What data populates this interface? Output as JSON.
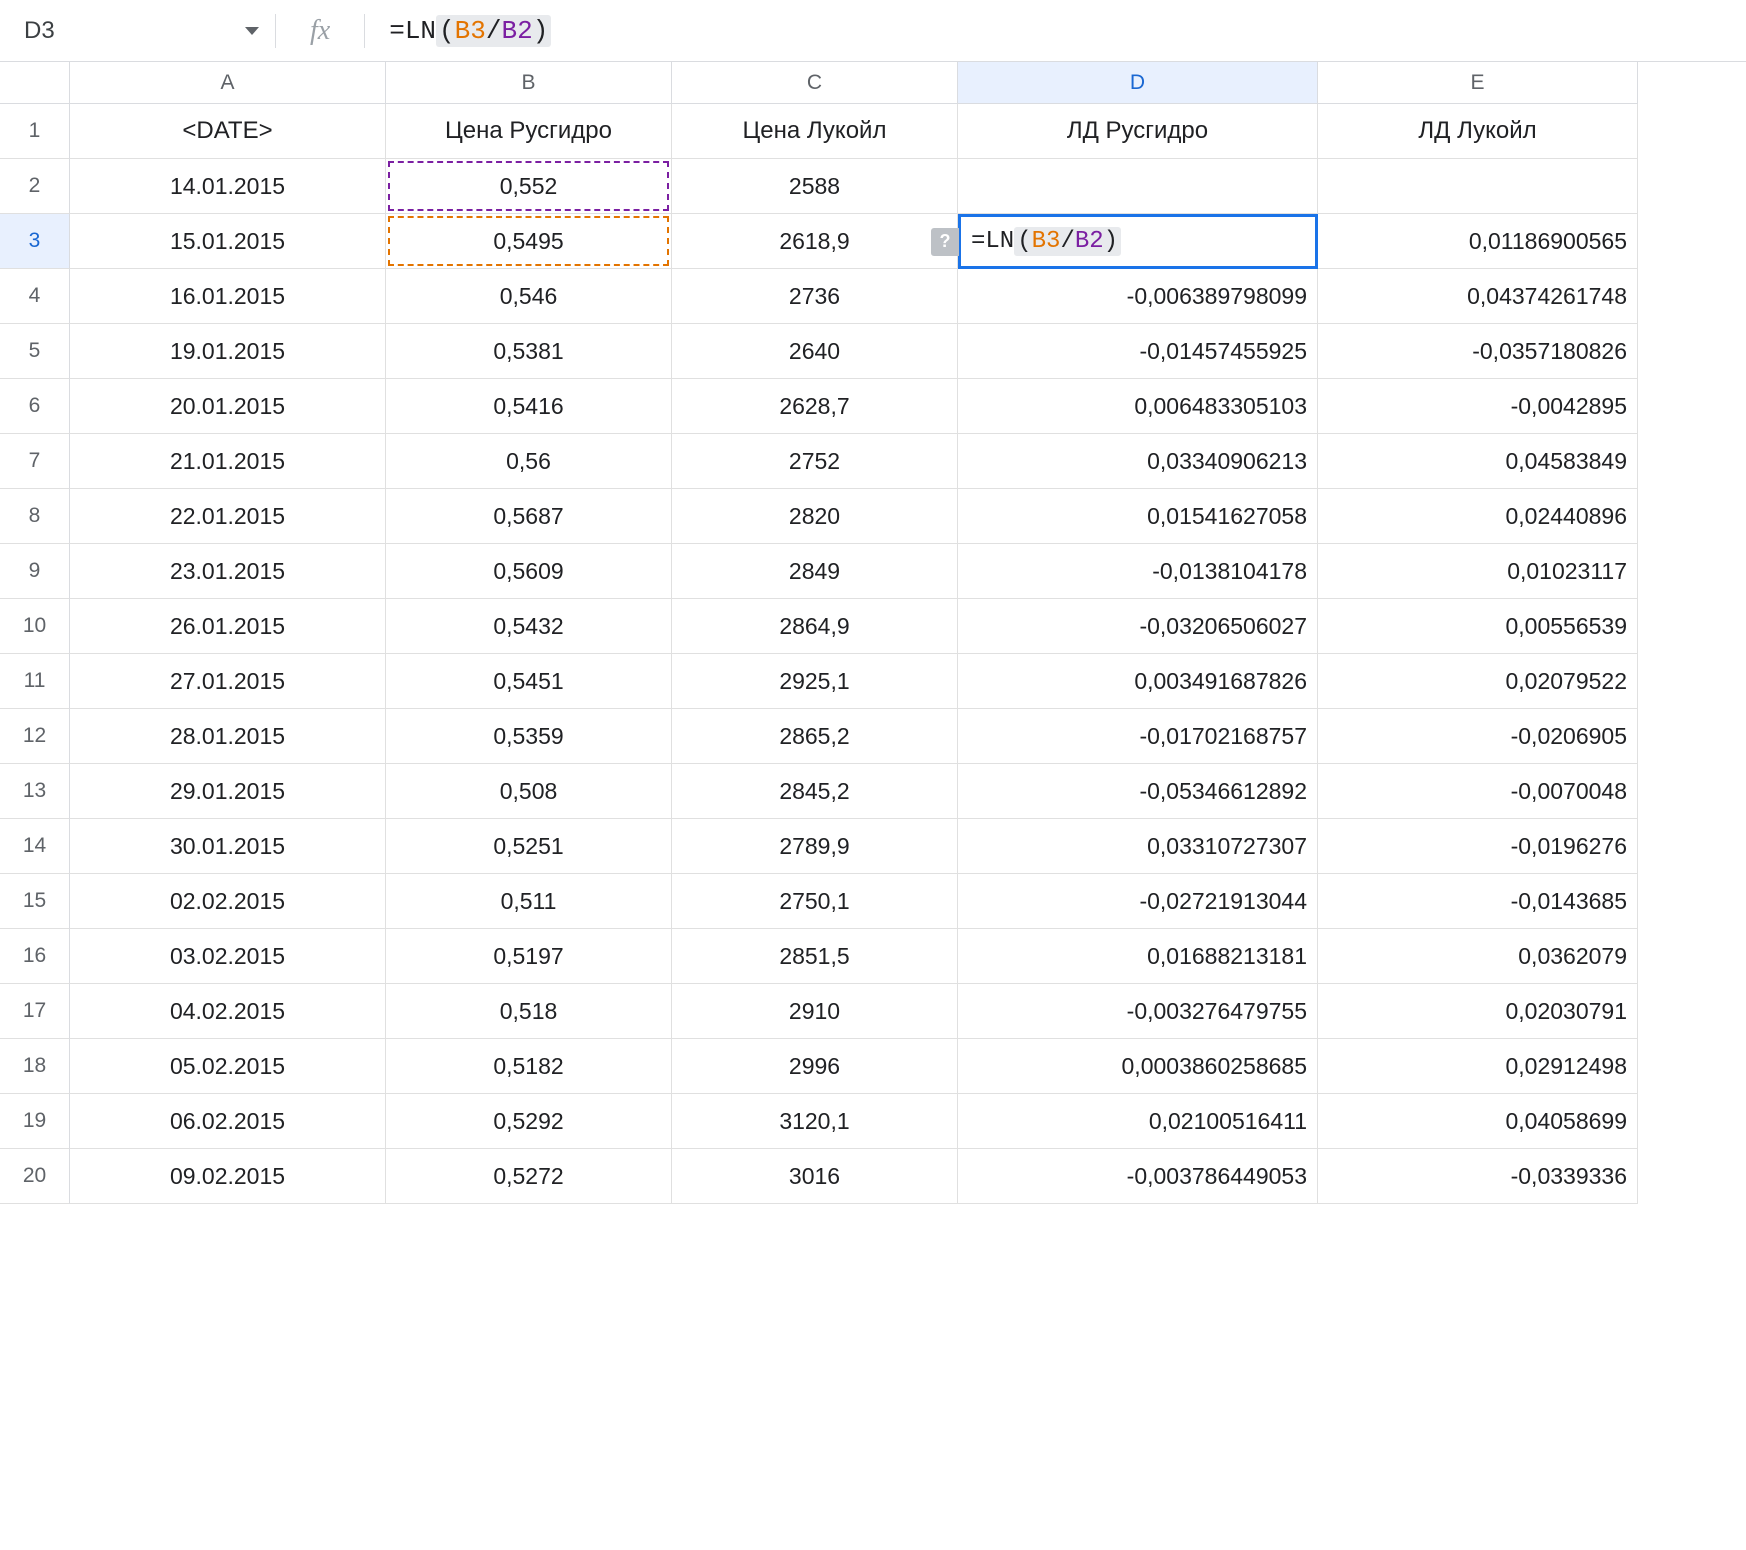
{
  "namebox": "D3",
  "formula": {
    "eq": "=",
    "fn": "LN",
    "open": "(",
    "ref1": "B3",
    "op": "/",
    "ref2": "B2",
    "close": ")"
  },
  "fx_label": "fx",
  "help_icon": "?",
  "columns": [
    "A",
    "B",
    "C",
    "D",
    "E"
  ],
  "headers": {
    "A": "<DATE>",
    "B": "Цена Русгидро",
    "C": "Цена Лукойл",
    "D": "ЛД Русгидро",
    "E": "ЛД Лукойл"
  },
  "rows": [
    {
      "n": "2",
      "A": "14.01.2015",
      "B": "0,552",
      "C": "2588",
      "D": "",
      "E": ""
    },
    {
      "n": "3",
      "A": "15.01.2015",
      "B": "0,5495",
      "C": "2618,9",
      "D": "__EDIT__",
      "E": "0,01186900565"
    },
    {
      "n": "4",
      "A": "16.01.2015",
      "B": "0,546",
      "C": "2736",
      "D": "-0,006389798099",
      "E": "0,04374261748"
    },
    {
      "n": "5",
      "A": "19.01.2015",
      "B": "0,5381",
      "C": "2640",
      "D": "-0,01457455925",
      "E": "-0,0357180826"
    },
    {
      "n": "6",
      "A": "20.01.2015",
      "B": "0,5416",
      "C": "2628,7",
      "D": "0,006483305103",
      "E": "-0,0042895"
    },
    {
      "n": "7",
      "A": "21.01.2015",
      "B": "0,56",
      "C": "2752",
      "D": "0,03340906213",
      "E": "0,04583849"
    },
    {
      "n": "8",
      "A": "22.01.2015",
      "B": "0,5687",
      "C": "2820",
      "D": "0,01541627058",
      "E": "0,02440896"
    },
    {
      "n": "9",
      "A": "23.01.2015",
      "B": "0,5609",
      "C": "2849",
      "D": "-0,0138104178",
      "E": "0,01023117"
    },
    {
      "n": "10",
      "A": "26.01.2015",
      "B": "0,5432",
      "C": "2864,9",
      "D": "-0,03206506027",
      "E": "0,00556539"
    },
    {
      "n": "11",
      "A": "27.01.2015",
      "B": "0,5451",
      "C": "2925,1",
      "D": "0,003491687826",
      "E": "0,02079522"
    },
    {
      "n": "12",
      "A": "28.01.2015",
      "B": "0,5359",
      "C": "2865,2",
      "D": "-0,01702168757",
      "E": "-0,0206905"
    },
    {
      "n": "13",
      "A": "29.01.2015",
      "B": "0,508",
      "C": "2845,2",
      "D": "-0,05346612892",
      "E": "-0,0070048"
    },
    {
      "n": "14",
      "A": "30.01.2015",
      "B": "0,5251",
      "C": "2789,9",
      "D": "0,03310727307",
      "E": "-0,0196276"
    },
    {
      "n": "15",
      "A": "02.02.2015",
      "B": "0,511",
      "C": "2750,1",
      "D": "-0,02721913044",
      "E": "-0,0143685"
    },
    {
      "n": "16",
      "A": "03.02.2015",
      "B": "0,5197",
      "C": "2851,5",
      "D": "0,01688213181",
      "E": "0,0362079"
    },
    {
      "n": "17",
      "A": "04.02.2015",
      "B": "0,518",
      "C": "2910",
      "D": "-0,003276479755",
      "E": "0,02030791"
    },
    {
      "n": "18",
      "A": "05.02.2015",
      "B": "0,5182",
      "C": "2996",
      "D": "0,0003860258685",
      "E": "0,02912498"
    },
    {
      "n": "19",
      "A": "06.02.2015",
      "B": "0,5292",
      "C": "3120,1",
      "D": "0,02100516411",
      "E": "0,04058699"
    },
    {
      "n": "20",
      "A": "09.02.2015",
      "B": "0,5272",
      "C": "3016",
      "D": "-0,003786449053",
      "E": "-0,0339336"
    }
  ]
}
